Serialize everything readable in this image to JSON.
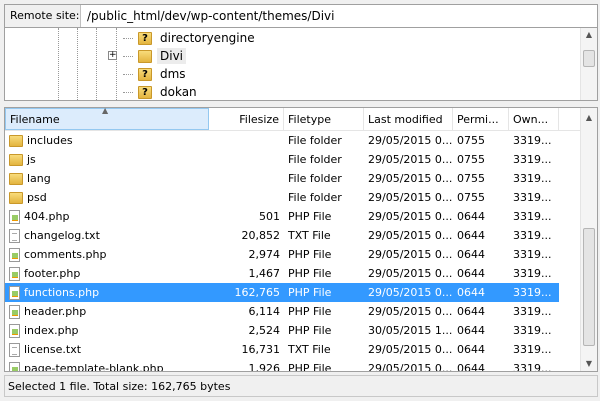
{
  "remote_site": {
    "label": "Remote site:",
    "path": "/public_html/dev/wp-content/themes/Divi"
  },
  "tree": [
    {
      "name": "directoryengine",
      "icon": "folder-question-icon"
    },
    {
      "name": "Divi",
      "icon": "folder-icon",
      "selected": true,
      "expandable": true
    },
    {
      "name": "dms",
      "icon": "folder-question-icon"
    },
    {
      "name": "dokan",
      "icon": "folder-question-icon"
    }
  ],
  "columns": [
    "Filename",
    "Filesize",
    "Filetype",
    "Last modified",
    "Permi...",
    "Own..."
  ],
  "files": [
    {
      "name": "includes",
      "size": "",
      "type": "File folder",
      "modified": "29/05/2015 0...",
      "perm": "0755",
      "owner": "3319...",
      "icon": "folder"
    },
    {
      "name": "js",
      "size": "",
      "type": "File folder",
      "modified": "29/05/2015 0...",
      "perm": "0755",
      "owner": "3319...",
      "icon": "folder"
    },
    {
      "name": "lang",
      "size": "",
      "type": "File folder",
      "modified": "29/05/2015 0...",
      "perm": "0755",
      "owner": "3319...",
      "icon": "folder"
    },
    {
      "name": "psd",
      "size": "",
      "type": "File folder",
      "modified": "29/05/2015 0...",
      "perm": "0755",
      "owner": "3319...",
      "icon": "folder"
    },
    {
      "name": "404.php",
      "size": "501",
      "type": "PHP File",
      "modified": "29/05/2015 0...",
      "perm": "0644",
      "owner": "3319...",
      "icon": "php"
    },
    {
      "name": "changelog.txt",
      "size": "20,852",
      "type": "TXT File",
      "modified": "29/05/2015 0...",
      "perm": "0644",
      "owner": "3319...",
      "icon": "txt"
    },
    {
      "name": "comments.php",
      "size": "2,974",
      "type": "PHP File",
      "modified": "29/05/2015 0...",
      "perm": "0644",
      "owner": "3319...",
      "icon": "php"
    },
    {
      "name": "footer.php",
      "size": "1,467",
      "type": "PHP File",
      "modified": "29/05/2015 0...",
      "perm": "0644",
      "owner": "3319...",
      "icon": "php"
    },
    {
      "name": "functions.php",
      "size": "162,765",
      "type": "PHP File",
      "modified": "29/05/2015 0...",
      "perm": "0644",
      "owner": "3319...",
      "icon": "php",
      "selected": true
    },
    {
      "name": "header.php",
      "size": "6,114",
      "type": "PHP File",
      "modified": "29/05/2015 0...",
      "perm": "0644",
      "owner": "3319...",
      "icon": "php"
    },
    {
      "name": "index.php",
      "size": "2,524",
      "type": "PHP File",
      "modified": "30/05/2015 1...",
      "perm": "0644",
      "owner": "3319...",
      "icon": "php"
    },
    {
      "name": "license.txt",
      "size": "16,731",
      "type": "TXT File",
      "modified": "29/05/2015 0...",
      "perm": "0644",
      "owner": "3319...",
      "icon": "txt"
    },
    {
      "name": "page-template-blank.php",
      "size": "1,926",
      "type": "PHP File",
      "modified": "29/05/2015 0...",
      "perm": "0644",
      "owner": "3319...",
      "icon": "php"
    }
  ],
  "status": "Selected 1 file. Total size: 162,765 bytes"
}
